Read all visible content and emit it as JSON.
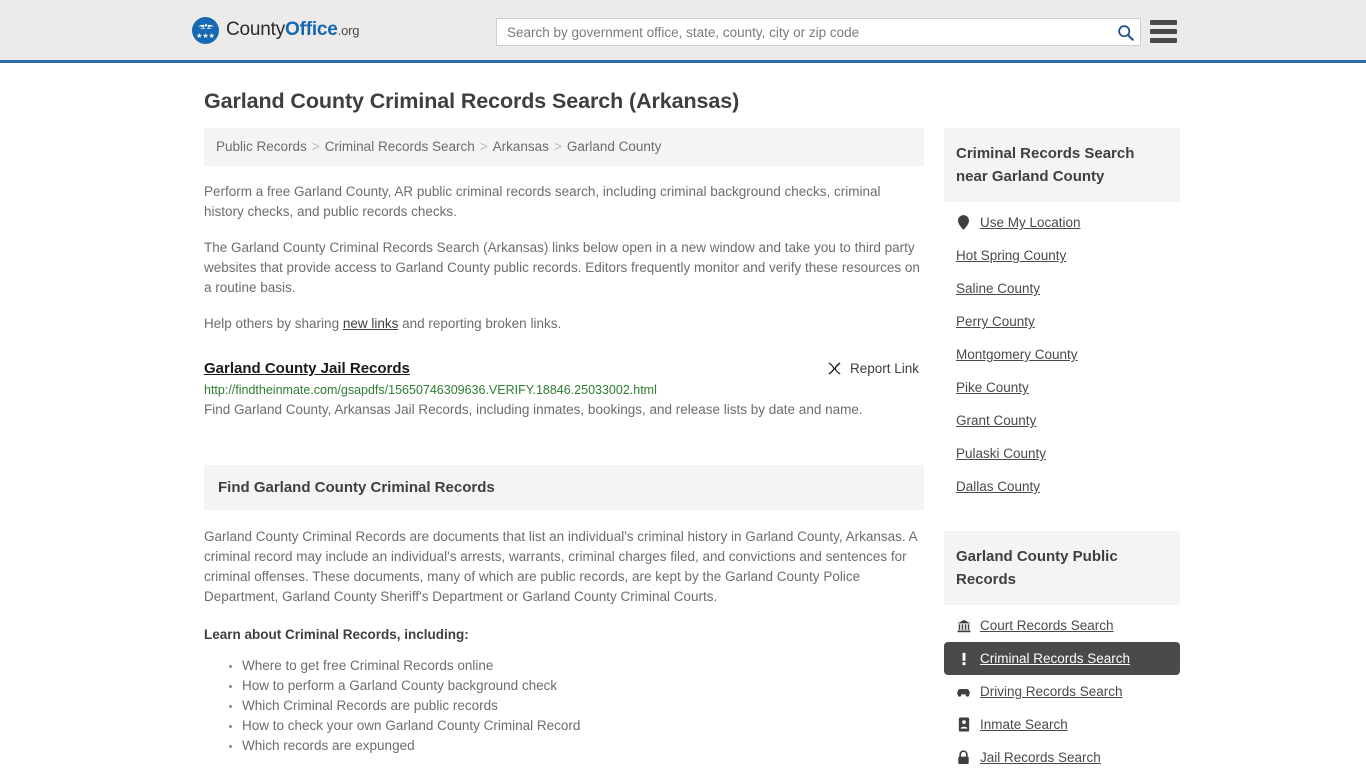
{
  "header": {
    "logo": {
      "icon": "eagle-seal-icon",
      "text_county": "County",
      "text_office": "Office",
      "text_tld": ".org",
      "brand_blue": "#1668b3"
    },
    "search": {
      "placeholder": "Search by government office, state, county, city or zip code",
      "value": "",
      "search_icon": "search-icon"
    },
    "menu_icon": "hamburger-menu-icon",
    "accent_border": "#2e6da4",
    "background": "#ecebe9"
  },
  "page": {
    "title": "Garland County Criminal Records Search (Arkansas)"
  },
  "breadcrumb": {
    "separator": ">",
    "items": [
      "Public Records",
      "Criminal Records Search",
      "Arkansas",
      "Garland County"
    ]
  },
  "intro": {
    "p1": "Perform a free Garland County, AR public criminal records search, including criminal background checks, criminal history checks, and public records checks.",
    "p2": "The Garland County Criminal Records Search (Arkansas) links below open in a new window and take you to third party websites that provide access to Garland County public records. Editors frequently monitor and verify these resources on a routine basis.",
    "p3_before": "Help others by sharing ",
    "p3_link": "new links",
    "p3_after": " and reporting broken links."
  },
  "record": {
    "title": "Garland County Jail Records",
    "url": "http://findtheinmate.com/gsapdfs/15650746309636.VERIFY.18846.25033002.html",
    "description": "Find Garland County, Arkansas Jail Records, including inmates, bookings, and release lists by date and name.",
    "report_label": "Report Link",
    "report_icon": "broken-link-icon",
    "url_color": "#2e7d32"
  },
  "find_section": {
    "heading": "Find Garland County Criminal Records",
    "body": "Garland County Criminal Records are documents that list an individual's criminal history in Garland County, Arkansas. A criminal record may include an individual's arrests, warrants, criminal charges filed, and convictions and sentences for criminal offenses. These documents, many of which are public records, are kept by the Garland County Police Department, Garland County Sheriff's Department or Garland County Criminal Courts.",
    "learn_heading": "Learn about Criminal Records, including:",
    "learn_items": [
      "Where to get free Criminal Records online",
      "How to perform a Garland County background check",
      "Which Criminal Records are public records",
      "How to check your own Garland County Criminal Record",
      "Which records are expunged"
    ]
  },
  "sidebar": {
    "nearby": {
      "heading": "Criminal Records Search near Garland County",
      "items": [
        {
          "label": "Use My Location",
          "icon": "map-pin-icon",
          "has_icon": true
        },
        {
          "label": "Hot Spring County",
          "icon": "",
          "has_icon": false
        },
        {
          "label": "Saline County",
          "icon": "",
          "has_icon": false
        },
        {
          "label": "Perry County",
          "icon": "",
          "has_icon": false
        },
        {
          "label": "Montgomery County",
          "icon": "",
          "has_icon": false
        },
        {
          "label": "Pike County",
          "icon": "",
          "has_icon": false
        },
        {
          "label": "Grant County",
          "icon": "",
          "has_icon": false
        },
        {
          "label": "Pulaski County",
          "icon": "",
          "has_icon": false
        },
        {
          "label": "Dallas County",
          "icon": "",
          "has_icon": false
        }
      ]
    },
    "public_records": {
      "heading": "Garland County Public Records",
      "active_background": "#4a4a4a",
      "items": [
        {
          "label": "Court Records Search",
          "icon": "courthouse-icon",
          "active": false
        },
        {
          "label": "Criminal Records Search",
          "icon": "exclamation-icon",
          "active": true
        },
        {
          "label": "Driving Records Search",
          "icon": "car-icon",
          "active": false
        },
        {
          "label": "Inmate Search",
          "icon": "id-badge-icon",
          "active": false
        },
        {
          "label": "Jail Records Search",
          "icon": "lock-icon",
          "active": false
        }
      ]
    }
  }
}
